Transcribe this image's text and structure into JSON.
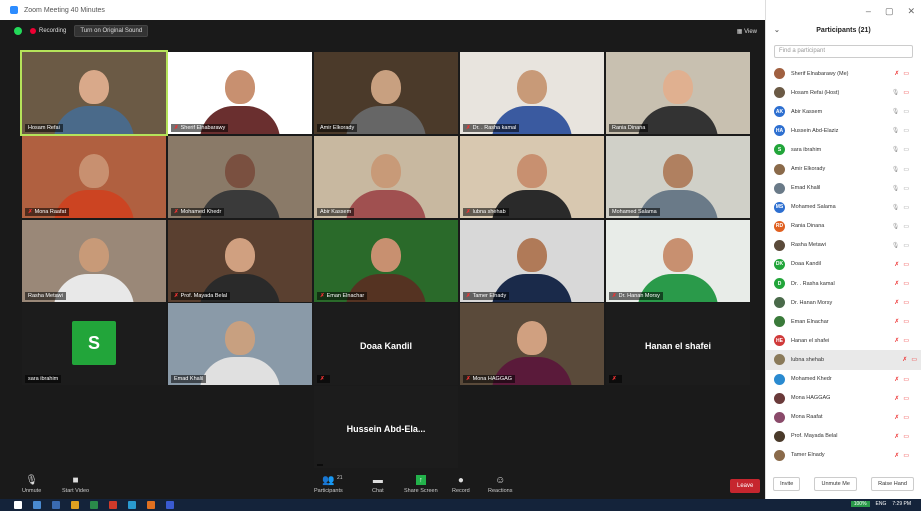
{
  "window": {
    "title": "Zoom Meeting 40 Minutes"
  },
  "meeting_bar": {
    "recording": "Recording",
    "original_sound": "Turn on Original Sound",
    "view": "View"
  },
  "tiles": [
    {
      "name": "Hosam Refai",
      "muted": false,
      "active": true,
      "bg": "#6b5a45",
      "skin": "#d9a98a",
      "shirt": "#4a6a8a"
    },
    {
      "name": "Sherif Elnabarawy",
      "muted": true,
      "bg": "#ffffff",
      "skin": "#c89070",
      "shirt": "#6a2f2f"
    },
    {
      "name": "Amir Elkorady",
      "muted": false,
      "bg": "#4b3a2a",
      "skin": "#c8a080",
      "shirt": "#666"
    },
    {
      "name": "Dr. . Rasha kamal",
      "muted": true,
      "bg": "#e8e4de",
      "skin": "#c89a78",
      "shirt": "#3a5aa0"
    },
    {
      "name": "Rania Dinana",
      "muted": false,
      "bg": "#c8c0b0",
      "skin": "#e0b090",
      "shirt": "#333"
    },
    {
      "name": "Mona Raafat",
      "muted": true,
      "bg": "#b06040",
      "skin": "#c89070",
      "shirt": "#cc4422"
    },
    {
      "name": "Mohamed Khedr",
      "muted": true,
      "bg": "#8a7a68",
      "skin": "#7a5040",
      "shirt": "#3a3a3a"
    },
    {
      "name": "Abir Kassem",
      "muted": false,
      "bg": "#c8b8a0",
      "skin": "#c89a78",
      "shirt": "#a05050"
    },
    {
      "name": "lubna shehab",
      "muted": true,
      "bg": "#d8c8b0",
      "skin": "#c89070",
      "shirt": "#2a2a2a"
    },
    {
      "name": "Mohamed Salama",
      "muted": false,
      "bg": "#d0d0c8",
      "skin": "#b08060",
      "shirt": "#6a7a88"
    },
    {
      "name": "Rasha Metawi",
      "muted": false,
      "bg": "#9a8878",
      "skin": "#c89a78",
      "shirt": "#e8e8e8"
    },
    {
      "name": "Prof. Mayada Belal",
      "muted": true,
      "bg": "#5a4030",
      "skin": "#d0a080",
      "shirt": "#2a2a2a"
    },
    {
      "name": "Eman Elnachar",
      "muted": true,
      "bg": "#2a6a2a",
      "skin": "#c89070",
      "shirt": "#553322"
    },
    {
      "name": "Tamer Elnady",
      "muted": true,
      "bg": "#d8d8d8",
      "skin": "#b07a58",
      "shirt": "#1a2a4a"
    },
    {
      "name": "Dr. Hanan Morsy",
      "muted": true,
      "bg": "#e8ece8",
      "skin": "#c89070",
      "shirt": "#2a9a4a"
    },
    {
      "name": "sara ibrahim",
      "muted": false,
      "letter": "S"
    },
    {
      "name": "Emad Khalil",
      "muted": false,
      "bg": "#8a9aa8",
      "skin": "#c8a080",
      "shirt": "#e0e0e0"
    },
    {
      "name": "Doaa Kandil",
      "muted": true,
      "big": true
    },
    {
      "name": "Mona HAGGAG",
      "muted": true,
      "bg": "#5a4a3a",
      "skin": "#d0a080",
      "shirt": "#5a1a3a"
    },
    {
      "name": "Hanan el shafei",
      "muted": true,
      "big": true
    },
    {
      "name": "Hussein Abd-Ela...",
      "muted": false,
      "big": true
    }
  ],
  "toolbar": {
    "unmute": "Unmute",
    "start_video": "Start Video",
    "participants": "Participants",
    "participants_count": "21",
    "chat": "Chat",
    "share_screen": "Share Screen",
    "record": "Record",
    "reactions": "Reactions",
    "leave": "Leave"
  },
  "panel": {
    "title": "Participants (21)",
    "search_placeholder": "Find a participant",
    "invite": "Invite",
    "unmute_me": "Unmute Me",
    "raise_hand": "Raise Hand",
    "participants": [
      {
        "name": "Sherif Elnabarawy (Me)",
        "initials": "",
        "color": "#a06040",
        "muted": true,
        "video_off": true
      },
      {
        "name": "Hosam Refai (Host)",
        "initials": "",
        "color": "#6b5a45",
        "muted": false,
        "video_off": true
      },
      {
        "name": "Abir Kassem",
        "initials": "AK",
        "color": "#2d6fd0",
        "muted": false,
        "video_off": false
      },
      {
        "name": "Hussein Abd-Elaziz",
        "initials": "HA",
        "color": "#2d6fd0",
        "muted": false,
        "video_off": false
      },
      {
        "name": "sara ibrahim",
        "initials": "S",
        "color": "#22a53a",
        "muted": false,
        "video_off": false
      },
      {
        "name": "Amir Elkorady",
        "initials": "",
        "color": "#8a6a4a",
        "muted": false,
        "video_off": false
      },
      {
        "name": "Emad Khalil",
        "initials": "",
        "color": "#6a7a88",
        "muted": false,
        "video_off": false
      },
      {
        "name": "Mohamed Salama",
        "initials": "MS",
        "color": "#2d6fd0",
        "muted": false,
        "video_off": false
      },
      {
        "name": "Rania Dinana",
        "initials": "RD",
        "color": "#e06020",
        "muted": false,
        "video_off": false
      },
      {
        "name": "Rasha Metawi",
        "initials": "",
        "color": "#5a4a3a",
        "muted": false,
        "video_off": false
      },
      {
        "name": "Doaa Kandil",
        "initials": "DK",
        "color": "#22a53a",
        "muted": true,
        "video_off": true
      },
      {
        "name": "Dr. . Rasha kamal",
        "initials": "D",
        "color": "#22a53a",
        "muted": true,
        "video_off": true
      },
      {
        "name": "Dr. Hanan Morsy",
        "initials": "",
        "color": "#4a6a4a",
        "muted": true,
        "video_off": true
      },
      {
        "name": "Eman Elnachar",
        "initials": "",
        "color": "#3a7a3a",
        "muted": true,
        "video_off": true
      },
      {
        "name": "Hanan el shafei",
        "initials": "HE",
        "color": "#d03a3a",
        "muted": true,
        "video_off": true
      },
      {
        "name": "lubna shehab",
        "initials": "",
        "color": "#8a7a5a",
        "muted": true,
        "video_off": true,
        "highlight": true
      },
      {
        "name": "Mohamed Khedr",
        "initials": "",
        "color": "#2a8ad0",
        "muted": true,
        "video_off": true
      },
      {
        "name": "Mona HAGGAG",
        "initials": "",
        "color": "#6a3a3a",
        "muted": true,
        "video_off": true
      },
      {
        "name": "Mona Raafat",
        "initials": "",
        "color": "#8a4a6a",
        "muted": true,
        "video_off": true
      },
      {
        "name": "Prof. Mayada Belal",
        "initials": "",
        "color": "#4a3a2a",
        "muted": true,
        "video_off": true
      },
      {
        "name": "Tamer Elnady",
        "initials": "",
        "color": "#8a6a4a",
        "muted": true,
        "video_off": true
      }
    ]
  },
  "taskbar": {
    "battery": "100%",
    "lang": "ENG",
    "time": "7:29 PM"
  }
}
